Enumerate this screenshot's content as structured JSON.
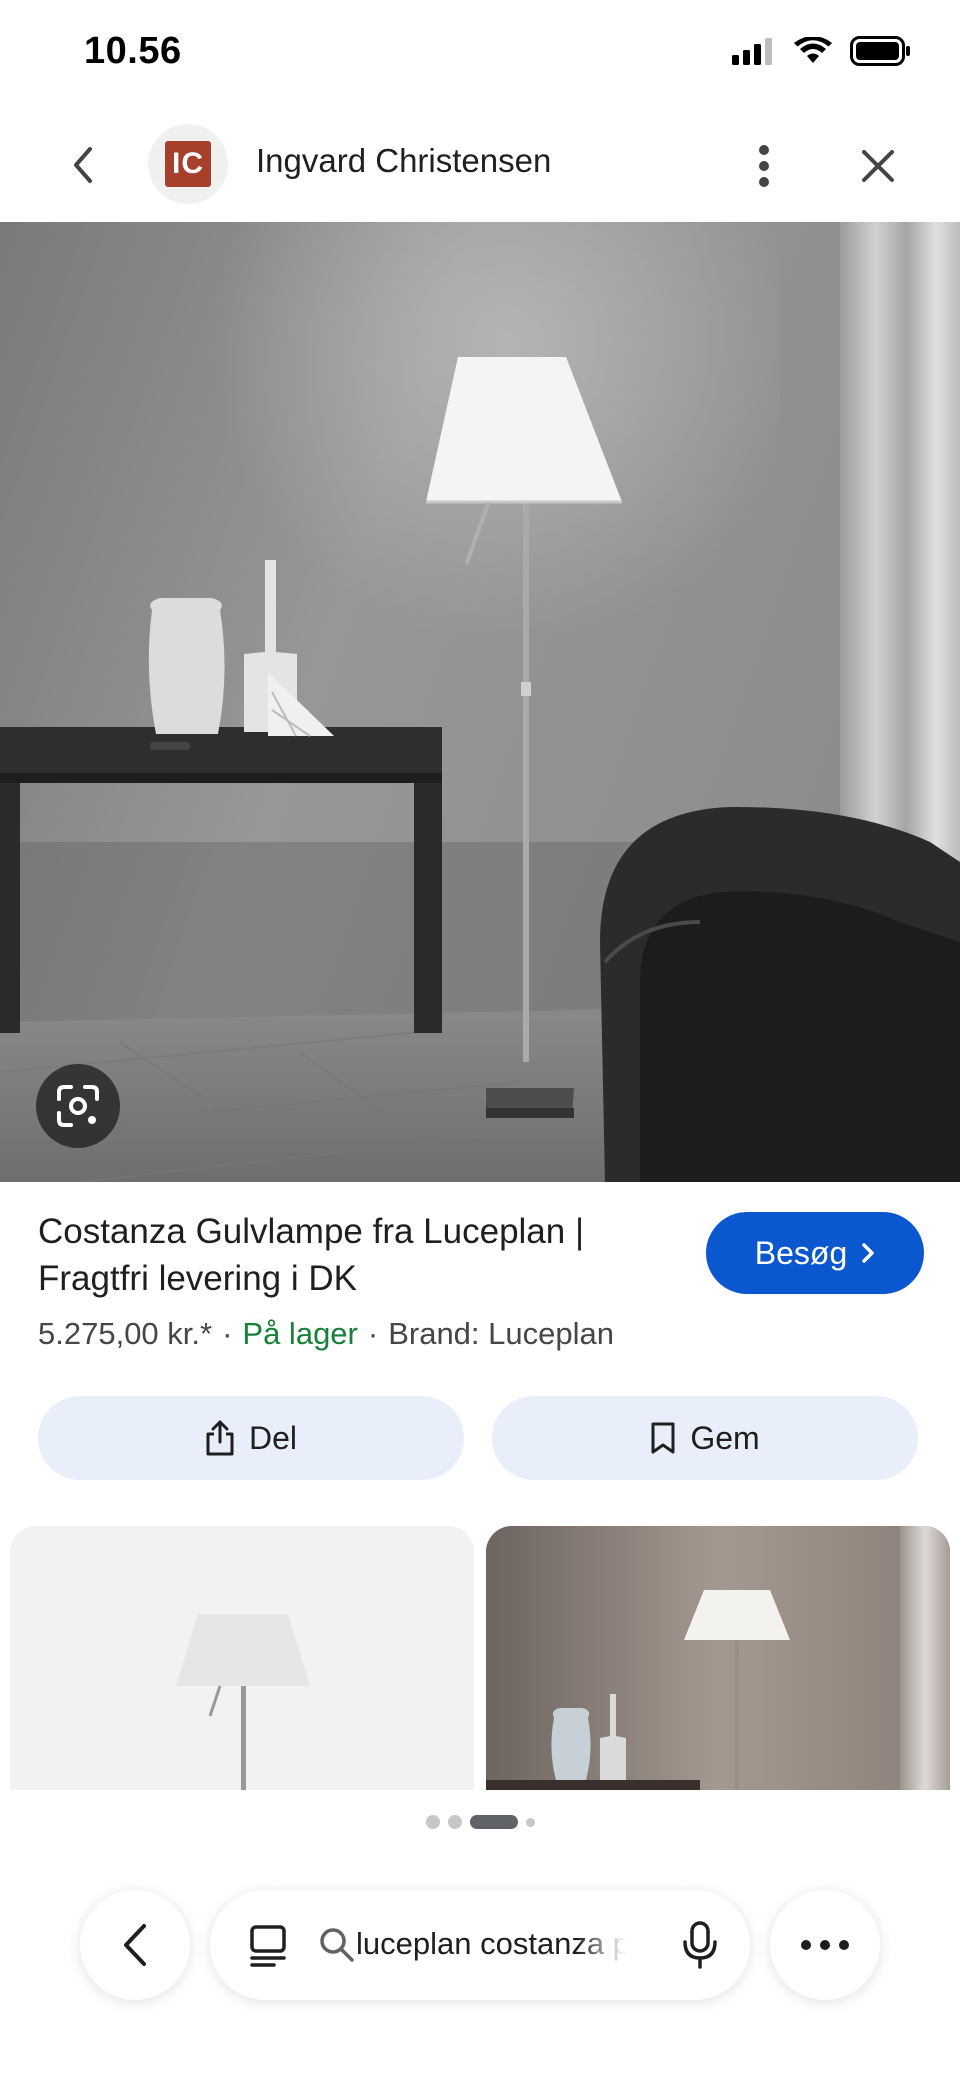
{
  "status_bar": {
    "time": "10.56",
    "icons": [
      "signal-icon",
      "wifi-icon",
      "battery-icon"
    ]
  },
  "header": {
    "site_logo_text": "IC",
    "site_name": "Ingvard Christensen",
    "icons": [
      "back-arrow-icon",
      "more-vert-icon",
      "close-icon"
    ]
  },
  "product": {
    "title": "Costanza Gulvlampe fra Luceplan | Fragtfri levering i DK",
    "visit_label": "Besøg",
    "price": "5.275,00 kr.*",
    "stock": "På lager",
    "brand": "Brand: Luceplan"
  },
  "actions": {
    "share_label": "Del",
    "save_label": "Gem"
  },
  "pager": {
    "count": 4,
    "active_index": 2
  },
  "bottom_bar": {
    "search_query": "luceplan costanza pris"
  },
  "colors": {
    "accent": "#0b57d0",
    "stock": "#188038",
    "chip_bg": "#e9eefb",
    "logo_bg": "#a6402a"
  }
}
